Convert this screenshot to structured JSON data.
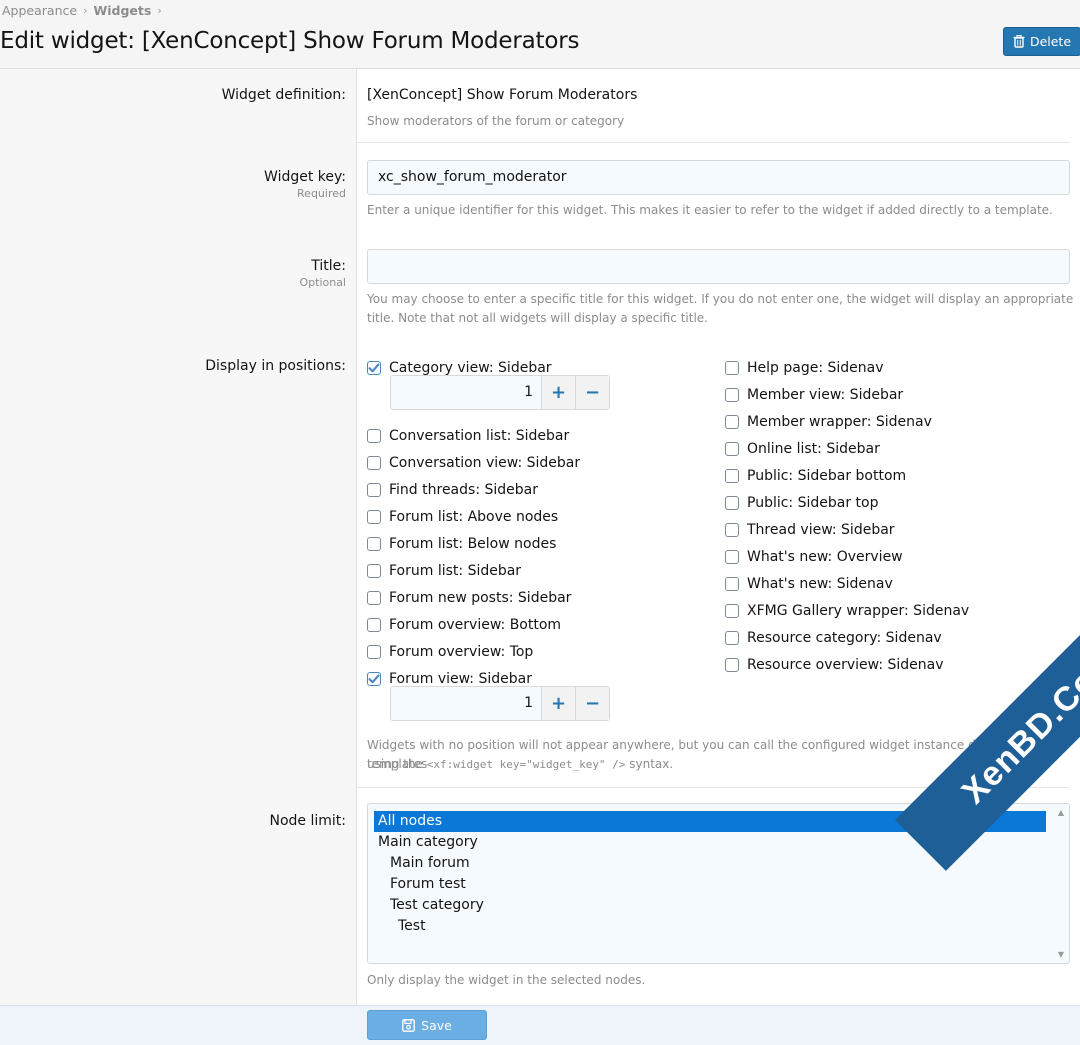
{
  "breadcrumb": {
    "items": [
      "Appearance",
      "Widgets"
    ]
  },
  "page": {
    "title": "Edit widget: [XenConcept] Show Forum Moderators"
  },
  "header": {
    "delete_label": "Delete"
  },
  "definition": {
    "label": "Widget definition:",
    "value": "[XenConcept] Show Forum Moderators",
    "description": "Show moderators of the forum or category"
  },
  "widget_key": {
    "label": "Widget key:",
    "hint": "Required",
    "value": "xc_show_forum_moderator",
    "explain": "Enter a unique identifier for this widget. This makes it easier to refer to the widget if added directly to a template."
  },
  "title_field": {
    "label": "Title:",
    "hint": "Optional",
    "value": "",
    "explain1": "You may choose to enter a specific title for this widget. If you do not enter one, the widget will display an appropriate",
    "explain2": "title. Note that not all widgets will display a specific title."
  },
  "positions": {
    "label": "Display in positions:",
    "left": [
      {
        "label": "Category view: Sidebar",
        "checked": true,
        "order": "1"
      },
      {
        "label": "Conversation list: Sidebar",
        "checked": false
      },
      {
        "label": "Conversation view: Sidebar",
        "checked": false
      },
      {
        "label": "Find threads: Sidebar",
        "checked": false
      },
      {
        "label": "Forum list: Above nodes",
        "checked": false
      },
      {
        "label": "Forum list: Below nodes",
        "checked": false
      },
      {
        "label": "Forum list: Sidebar",
        "checked": false
      },
      {
        "label": "Forum new posts: Sidebar",
        "checked": false
      },
      {
        "label": "Forum overview: Bottom",
        "checked": false
      },
      {
        "label": "Forum overview: Top",
        "checked": false
      },
      {
        "label": "Forum view: Sidebar",
        "checked": true,
        "order": "1"
      }
    ],
    "right": [
      {
        "label": "Help page: Sidenav",
        "checked": false
      },
      {
        "label": "Member view: Sidebar",
        "checked": false
      },
      {
        "label": "Member wrapper: Sidenav",
        "checked": false
      },
      {
        "label": "Online list: Sidebar",
        "checked": false
      },
      {
        "label": "Public: Sidebar bottom",
        "checked": false
      },
      {
        "label": "Public: Sidebar top",
        "checked": false
      },
      {
        "label": "Thread view: Sidebar",
        "checked": false
      },
      {
        "label": "What's new: Overview",
        "checked": false
      },
      {
        "label": "What's new: Sidenav",
        "checked": false
      },
      {
        "label": "XFMG Gallery wrapper: Sidenav",
        "checked": false
      },
      {
        "label": "Resource category: Sidenav",
        "checked": false
      },
      {
        "label": "Resource overview: Sidenav",
        "checked": false
      }
    ],
    "explain_prefix": "Widgets with no position will not appear anywhere, but you can call the configured widget instance directly in templates",
    "explain_using": "using the",
    "explain_code": "<xf:widget key=\"widget_key\" />",
    "explain_suffix": "syntax."
  },
  "node_limit": {
    "label": "Node limit:",
    "options": [
      {
        "label": "All nodes",
        "selected": true,
        "depth": 0
      },
      {
        "label": "Main category",
        "selected": false,
        "depth": 0
      },
      {
        "label": "Main forum",
        "selected": false,
        "depth": 1
      },
      {
        "label": "Forum test",
        "selected": false,
        "depth": 1
      },
      {
        "label": "Test category",
        "selected": false,
        "depth": 1
      },
      {
        "label": "Test",
        "selected": false,
        "depth": 2
      }
    ],
    "explain": "Only display the widget in the selected nodes."
  },
  "footer": {
    "save_label": "Save"
  },
  "watermark": {
    "text": "XenBD.Com"
  },
  "colors": {
    "accent": "#2577b1",
    "selected": "#0b78d7",
    "watermark": "#1f5f97"
  }
}
